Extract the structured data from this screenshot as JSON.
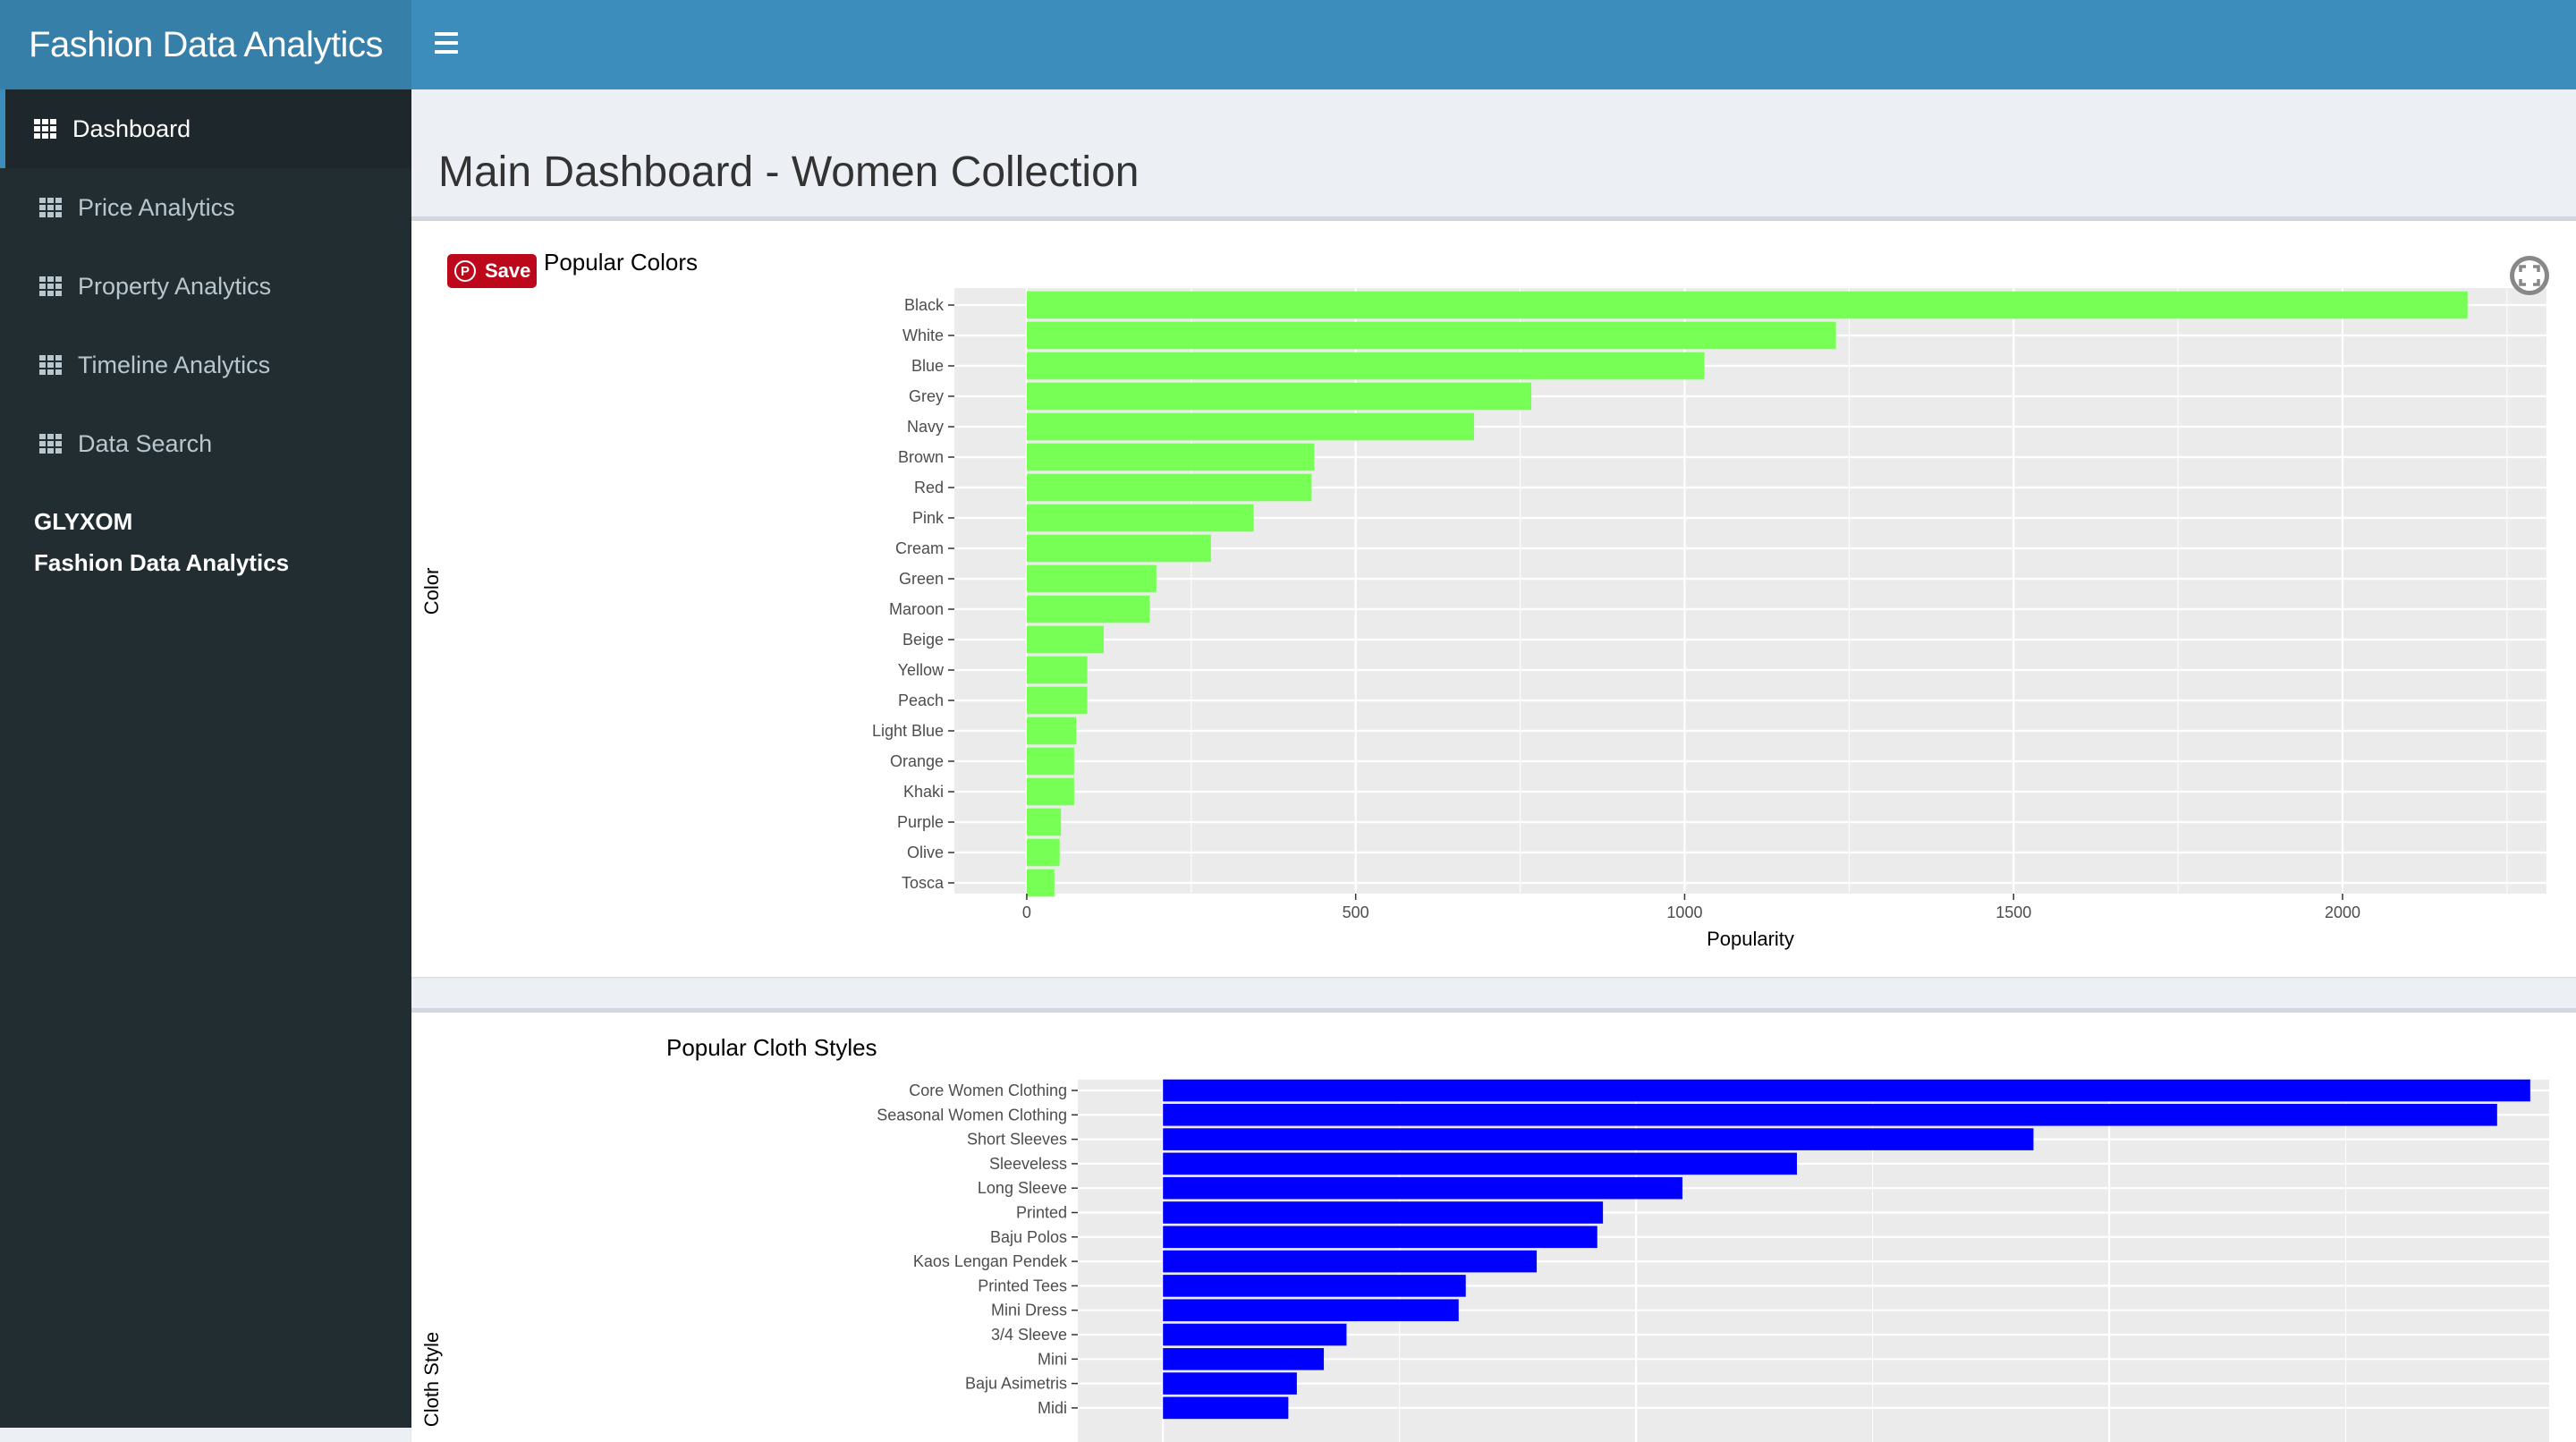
{
  "header": {
    "app_title": "Fashion Data Analytics"
  },
  "sidebar": {
    "items": [
      {
        "label": "Dashboard",
        "active": true
      },
      {
        "label": "Price Analytics"
      },
      {
        "label": "Property Analytics"
      },
      {
        "label": "Timeline Analytics"
      },
      {
        "label": "Data Search"
      }
    ],
    "brand_line1": "GLYXOM",
    "brand_line2": "Fashion Data Analytics"
  },
  "main": {
    "title": "Main Dashboard - Women Collection",
    "save_label": "Save"
  },
  "colors": {
    "accent": "#3c8dbc",
    "sidebar": "#222d32",
    "bar1": "#77ff55",
    "bar2": "#0000ff"
  },
  "chart_data": [
    {
      "type": "bar",
      "orientation": "horizontal",
      "title": "Popular Colors",
      "xlabel": "Popularity",
      "ylabel": "Color",
      "xlim": [
        -110,
        2310
      ],
      "xticks": [
        0,
        500,
        1000,
        1500,
        2000
      ],
      "categories": [
        "Black",
        "White",
        "Blue",
        "Grey",
        "Navy",
        "Brown",
        "Red",
        "Pink",
        "Cream",
        "Green",
        "Maroon",
        "Beige",
        "Yellow",
        "Peach",
        "Light Blue",
        "Orange",
        "Khaki",
        "Purple",
        "Olive",
        "Tosca"
      ],
      "values": [
        2190,
        1230,
        1030,
        767,
        680,
        437,
        433,
        345,
        280,
        197,
        187,
        117,
        92,
        92,
        75,
        72,
        72,
        52,
        50,
        42
      ],
      "grid": true
    },
    {
      "type": "bar",
      "orientation": "horizontal",
      "title": "Popular Cloth Styles",
      "xlabel": "",
      "ylabel": "Cloth Style",
      "xlim": [
        -180,
        2930
      ],
      "categories": [
        "Core Women Clothing",
        "Seasonal Women Clothing",
        "Short Sleeves",
        "Sleeveless",
        "Long Sleeve",
        "Printed",
        "Baju Polos",
        "Kaos Lengan Pendek",
        "Printed Tees",
        "Mini Dress",
        "3/4 Sleeve",
        "Mini",
        "Baju Asimetris",
        "Midi"
      ],
      "values": [
        2890,
        2820,
        1840,
        1340,
        1098,
        930,
        918,
        790,
        640,
        625,
        388,
        340,
        283,
        265
      ],
      "grid": true
    }
  ]
}
